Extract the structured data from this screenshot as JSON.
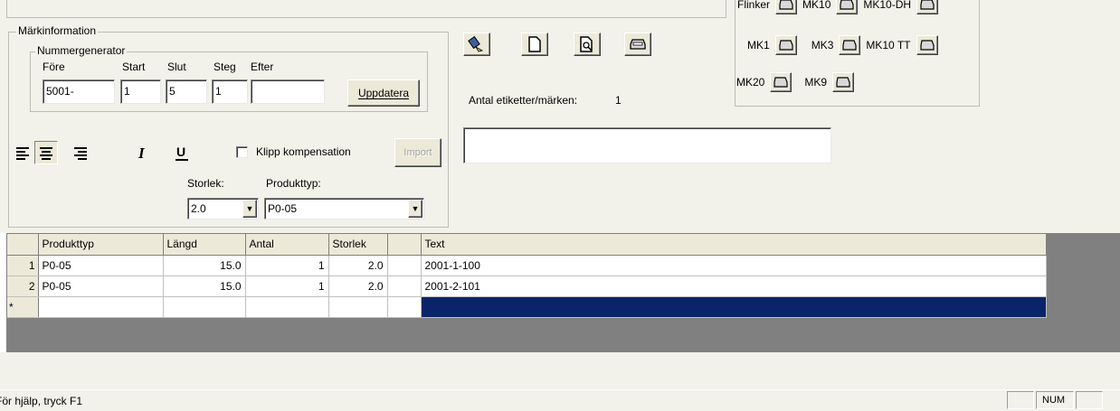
{
  "marking_group": {
    "legend": "Märkinformation"
  },
  "number_generator": {
    "legend": "Nummergenerator",
    "labels": {
      "before": "Före",
      "start": "Start",
      "end": "Slut",
      "step": "Steg",
      "after": "Efter"
    },
    "values": {
      "before": "5001-",
      "start": "1",
      "end": "5",
      "step": "1",
      "after": ""
    },
    "update_button": "Uppdatera"
  },
  "format": {
    "cut_compensation_label": "Klipp kompensation",
    "import_button": "Import",
    "size_label": "Storlek:",
    "size_value": "2.0",
    "product_type_label": "Produkttyp:",
    "product_type_value": "P0-05"
  },
  "labels_count": {
    "label": "Antal etiketter/märken:",
    "value": "1"
  },
  "printers": {
    "top_row": [
      "Flinker",
      "MK10",
      "MK10-DH"
    ],
    "row1": [
      "MK1",
      "MK3",
      "MK10 TT"
    ],
    "row2": [
      "MK20",
      "MK9"
    ]
  },
  "table": {
    "headers": [
      "Produkttyp",
      "Längd",
      "Antal",
      "Storlek",
      "",
      "Text"
    ],
    "rows": [
      {
        "index": "1",
        "product": "P0-05",
        "length": "15.0",
        "count": "1",
        "size": "2.0",
        "extra": "",
        "text": "2001-1-100"
      },
      {
        "index": "2",
        "product": "P0-05",
        "length": "15.0",
        "count": "1",
        "size": "2.0",
        "extra": "",
        "text": "2001-2-101"
      }
    ],
    "new_row_marker": "*"
  },
  "statusbar": {
    "help": "För hjälp, tryck F1",
    "panel_num": "NUM"
  },
  "colors": {
    "selection": "#0a246a",
    "panel_bg": "#f2f1ea",
    "grid_bg": "#808080"
  }
}
